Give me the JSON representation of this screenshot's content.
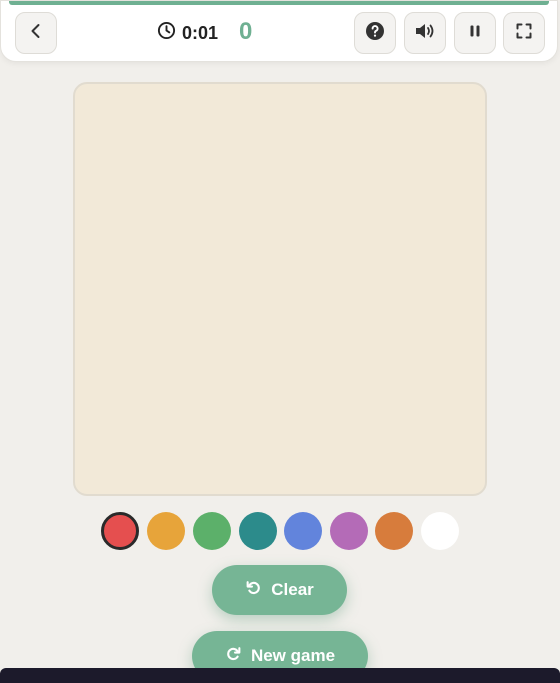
{
  "header": {
    "timer": "0:01",
    "score": "0",
    "icons": {
      "back": "chevron-left-icon",
      "timer": "clock-icon",
      "help": "question-circle-icon",
      "sound": "volume-icon",
      "pause": "pause-icon",
      "fullscreen": "fullscreen-icon"
    }
  },
  "palette": {
    "selected": "#e54f4f",
    "colors": [
      "#e54f4f",
      "#e7a43a",
      "#5cb06a",
      "#2c8b8b",
      "#6284dc",
      "#b46bb7",
      "#d77c3c",
      "#ffffff"
    ]
  },
  "board": {
    "background": "#f2e9d8"
  },
  "actions": {
    "clear_label": "Clear",
    "new_game_label": "New game"
  },
  "theme": {
    "accent": "#6fb092",
    "button": "#76b595"
  }
}
